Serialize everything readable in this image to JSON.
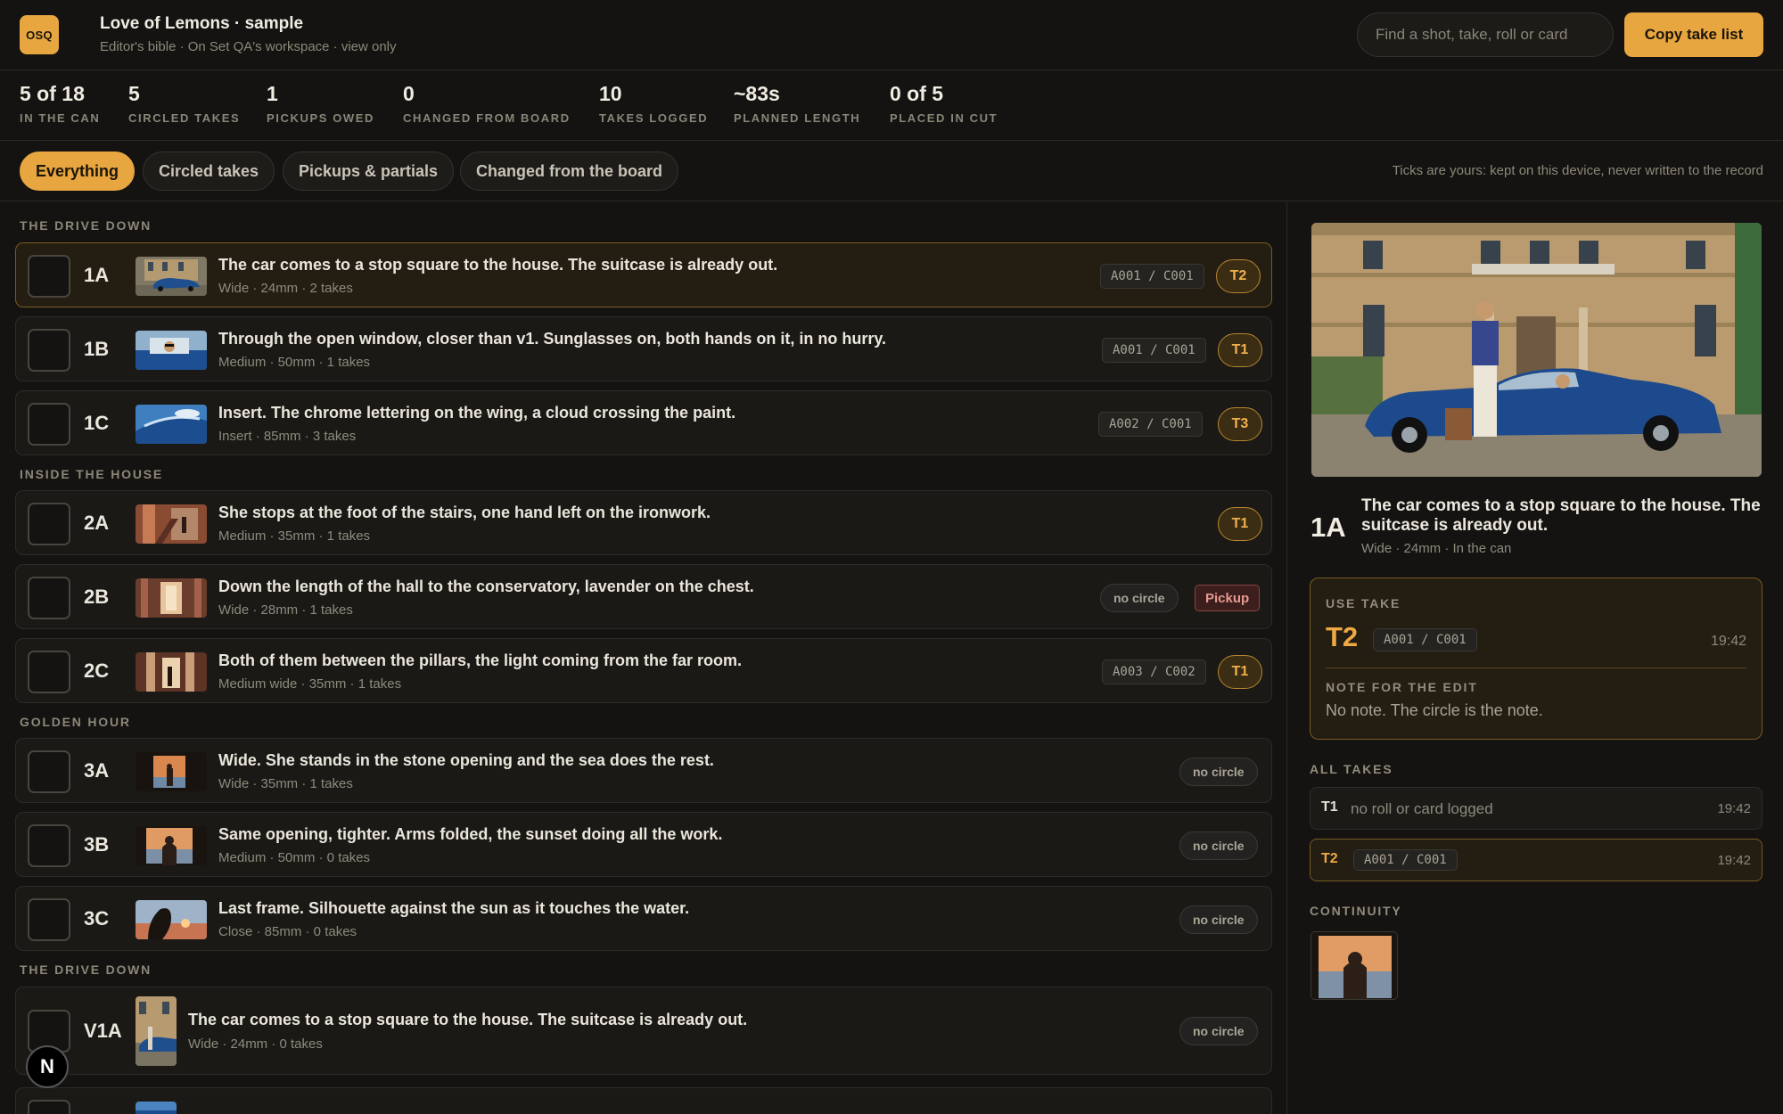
{
  "header": {
    "logo_text": "OSQ",
    "title": "Love of Lemons · sample",
    "subtitle": "Editor's bible · On Set QA's workspace · view only",
    "search_placeholder": "Find a shot, take, roll or card",
    "copy_button": "Copy take list"
  },
  "stats": [
    {
      "value": "5 of 18",
      "label": "In the can"
    },
    {
      "value": "5",
      "label": "Circled takes"
    },
    {
      "value": "1",
      "label": "Pickups owed"
    },
    {
      "value": "0",
      "label": "Changed from board"
    },
    {
      "value": "10",
      "label": "Takes logged"
    },
    {
      "value": "~83s",
      "label": "Planned length"
    },
    {
      "value": "0 of 5",
      "label": "Placed in cut"
    }
  ],
  "filters": {
    "chips": [
      "Everything",
      "Circled takes",
      "Pickups & partials",
      "Changed from the board"
    ],
    "active": "Everything",
    "hint": "Ticks are yours: kept on this device, never written to the record"
  },
  "sections": [
    "The drive down",
    "Inside the house",
    "Golden hour",
    "The drive down"
  ],
  "shots": [
    {
      "id": "1A",
      "title": "The car comes to a stop square to the house. The suitcase is already out.",
      "meta": "Wide · 24mm · 2 takes",
      "card": "A001 / C001",
      "take": "T2",
      "selected": true
    },
    {
      "id": "1B",
      "title": "Through the open window, closer than v1. Sunglasses on, both hands on it, in no hurry.",
      "meta": "Medium · 50mm · 1 takes",
      "card": "A001 / C001",
      "take": "T1"
    },
    {
      "id": "1C",
      "title": "Insert. The chrome lettering on the wing, a cloud crossing the paint.",
      "meta": "Insert · 85mm · 3 takes",
      "card": "A002 / C001",
      "take": "T3"
    },
    {
      "id": "2A",
      "title": "She stops at the foot of the stairs, one hand left on the ironwork.",
      "meta": "Medium · 35mm · 1 takes",
      "take": "T1"
    },
    {
      "id": "2B",
      "title": "Down the length of the hall to the conservatory, lavender on the chest.",
      "meta": "Wide · 28mm · 1 takes",
      "status": "no circle",
      "flag": "Pickup"
    },
    {
      "id": "2C",
      "title": "Both of them between the pillars, the light coming from the far room.",
      "meta": "Medium wide · 35mm · 1 takes",
      "card": "A003 / C002",
      "take": "T1"
    },
    {
      "id": "3A",
      "title": "Wide. She stands in the stone opening and the sea does the rest.",
      "meta": "Wide · 35mm · 1 takes",
      "status": "no circle"
    },
    {
      "id": "3B",
      "title": "Same opening, tighter. Arms folded, the sunset doing all the work.",
      "meta": "Medium · 50mm · 0 takes",
      "status": "no circle"
    },
    {
      "id": "3C",
      "title": "Last frame. Silhouette against the sun as it touches the water.",
      "meta": "Close · 85mm · 0 takes",
      "status": "no circle"
    },
    {
      "id": "V1A",
      "title": "The car comes to a stop square to the house. The suitcase is already out.",
      "meta": "Wide · 24mm · 0 takes",
      "status": "no circle"
    }
  ],
  "detail": {
    "id": "1A",
    "title": "The car comes to a stop square to the house. The suitcase is already out.",
    "meta": "Wide · 24mm · In the can",
    "use_take_label": "Use take",
    "use_take": "T2",
    "use_card": "A001 / C001",
    "use_time": "19:42",
    "note_label": "Note for the edit",
    "note": "No note. The circle is the note.",
    "all_takes_label": "All takes",
    "takes": [
      {
        "name": "T1",
        "note": "no roll or card logged",
        "time": "19:42"
      },
      {
        "name": "T2",
        "card": "A001 / C001",
        "time": "19:42"
      }
    ],
    "continuity_label": "Continuity"
  },
  "fab_label": "N",
  "colors": {
    "accent": "#e8a640",
    "background": "#141311",
    "panel": "#1a1916",
    "pickup": "#e79a90"
  }
}
